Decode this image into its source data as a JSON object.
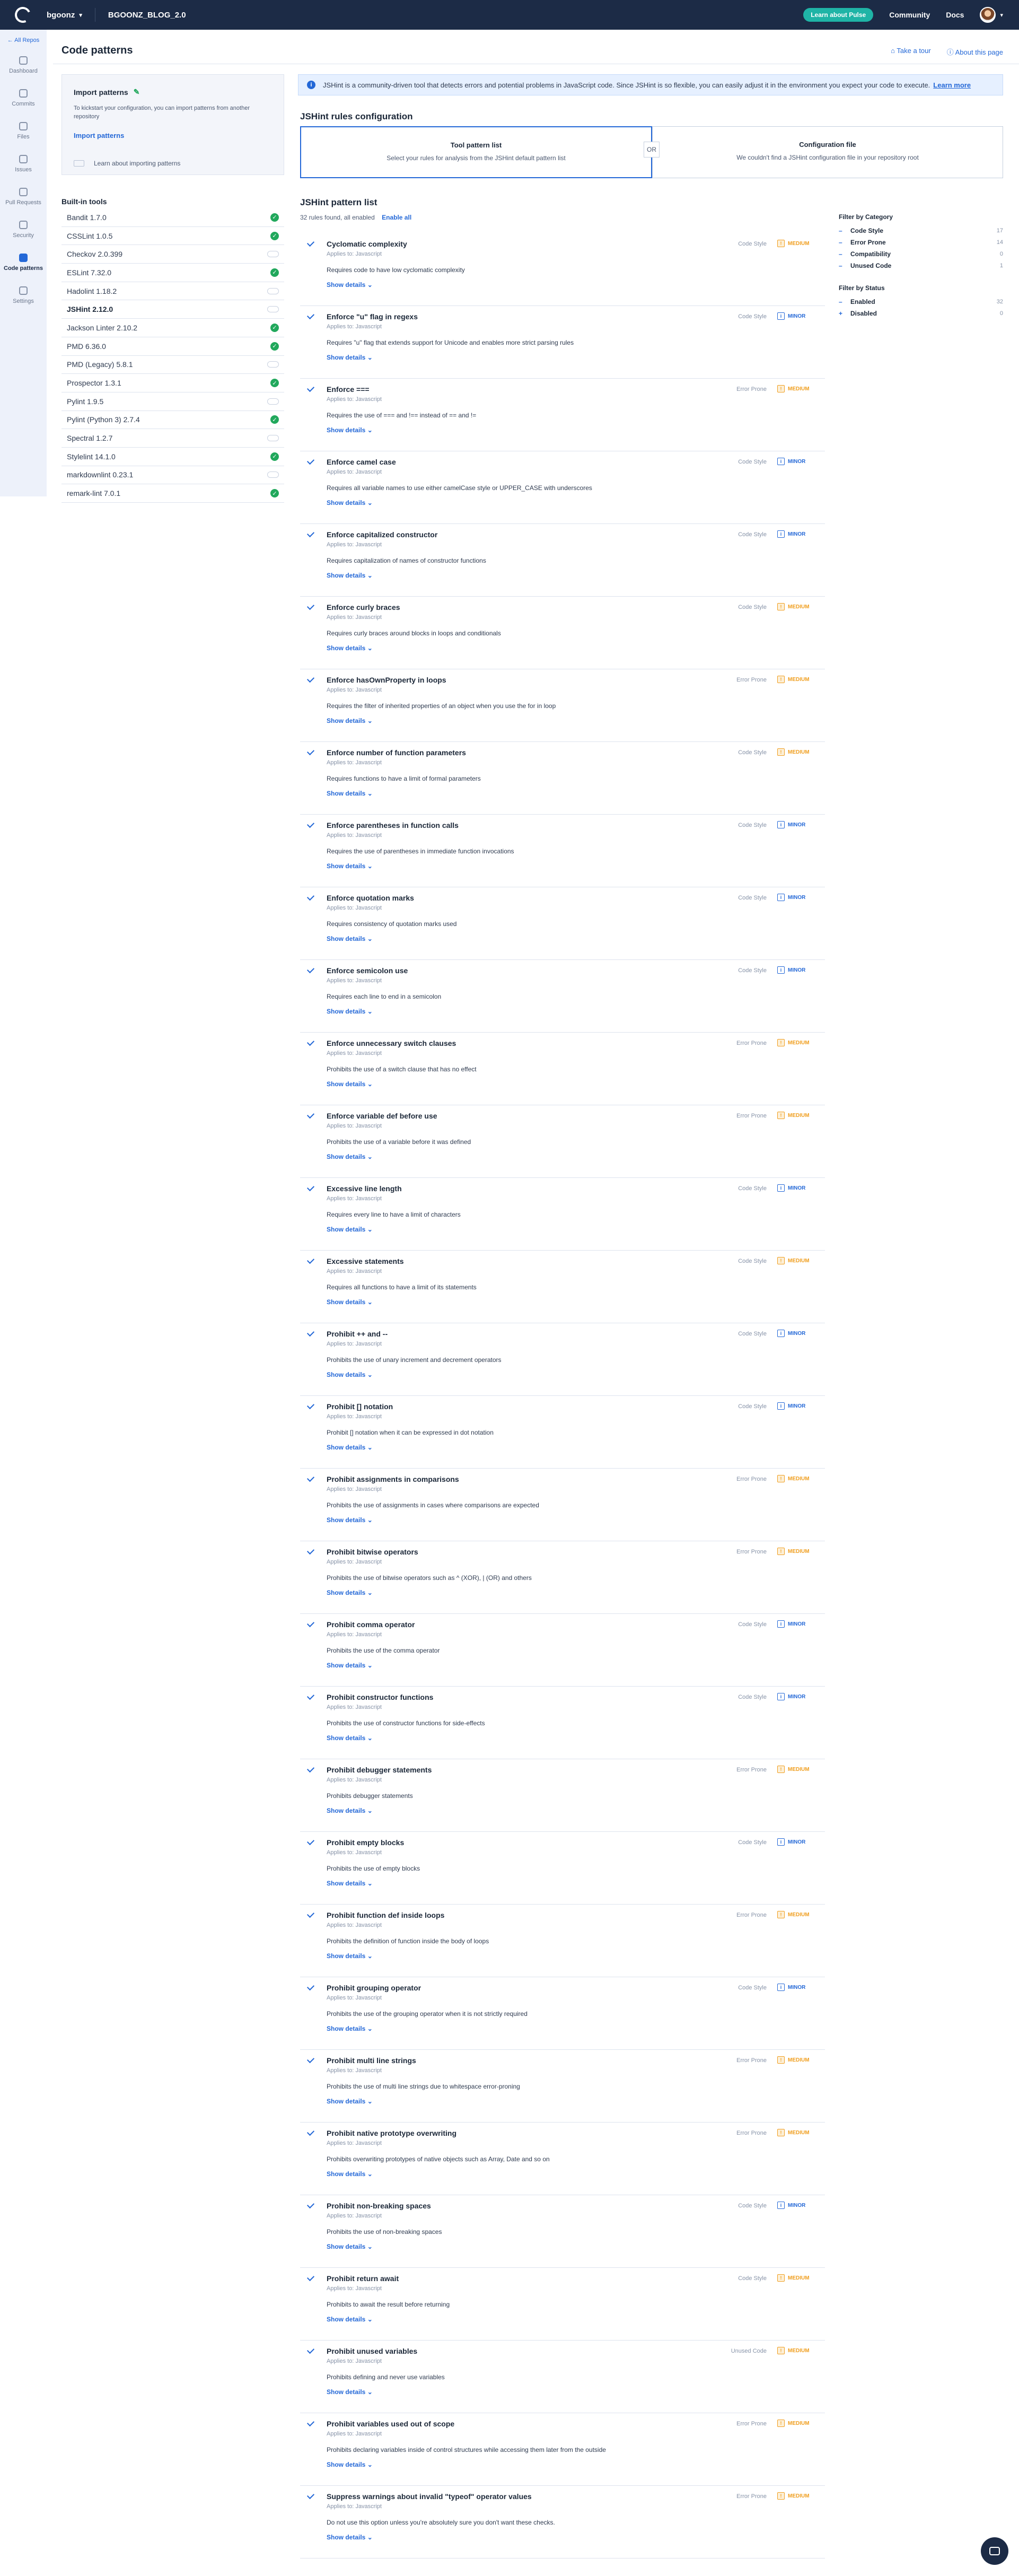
{
  "topbar": {
    "org": "bgoonz",
    "repo": "BGOONZ_BLOG_2.0",
    "pulse_button": "Learn about Pulse",
    "community": "Community",
    "docs": "Docs"
  },
  "sidebar": {
    "back": "← All Repos",
    "items": [
      {
        "label": "Dashboard",
        "icon": "dashboard-icon"
      },
      {
        "label": "Commits",
        "icon": "commits-icon"
      },
      {
        "label": "Files",
        "icon": "files-icon"
      },
      {
        "label": "Issues",
        "icon": "issues-icon"
      },
      {
        "label": "Pull Requests",
        "icon": "pull-requests-icon"
      },
      {
        "label": "Security",
        "icon": "security-icon"
      },
      {
        "label": "Code patterns",
        "icon": "code-patterns-icon"
      },
      {
        "label": "Settings",
        "icon": "settings-icon"
      }
    ]
  },
  "header": {
    "title": "Code patterns",
    "take_tour": "Take a tour",
    "about_page": "About this page"
  },
  "import": {
    "title": "Import patterns",
    "description": "To kickstart your configuration, you can import patterns from another repository",
    "link": "Import patterns",
    "learn": "Learn about importing patterns"
  },
  "builtin": {
    "title": "Built-in tools",
    "tools": [
      {
        "name": "Bandit 1.7.0",
        "enabled": true
      },
      {
        "name": "CSSLint 1.0.5",
        "enabled": true
      },
      {
        "name": "Checkov 2.0.399",
        "enabled": false
      },
      {
        "name": "ESLint 7.32.0",
        "enabled": true
      },
      {
        "name": "Hadolint 1.18.2",
        "enabled": false
      },
      {
        "name": "JSHint 2.12.0",
        "enabled": false,
        "selected": true
      },
      {
        "name": "Jackson Linter 2.10.2",
        "enabled": true
      },
      {
        "name": "PMD 6.36.0",
        "enabled": true
      },
      {
        "name": "PMD (Legacy) 5.8.1",
        "enabled": false
      },
      {
        "name": "Prospector 1.3.1",
        "enabled": true
      },
      {
        "name": "Pylint 1.9.5",
        "enabled": false
      },
      {
        "name": "Pylint (Python 3) 2.7.4",
        "enabled": true
      },
      {
        "name": "Spectral 1.2.7",
        "enabled": false
      },
      {
        "name": "Stylelint 14.1.0",
        "enabled": true
      },
      {
        "name": "markdownlint 0.23.1",
        "enabled": false
      },
      {
        "name": "remark-lint 7.0.1",
        "enabled": true
      }
    ]
  },
  "banner": {
    "text": "JSHint is a community-driven tool that detects errors and potential problems in JavaScript code. Since JSHint is so flexible, you can easily adjust it in the environment you expect your code to execute.",
    "link": "Learn more"
  },
  "config": {
    "title": "JSHint rules configuration",
    "option1_title": "Tool pattern list",
    "option1_desc": "Select your rules for analysis from the JSHint default pattern list",
    "or": "OR",
    "option2_title": "Configuration file",
    "option2_desc": "We couldn't find a JSHint configuration file in your repository root"
  },
  "rules_header": {
    "title": "JSHint pattern list",
    "summary": "32 rules found, all enabled",
    "enable_all": "Enable all"
  },
  "applies_to": "Applies to:",
  "language": "Javascript",
  "show_details": "Show details",
  "rules": [
    {
      "name": "Cyclomatic complexity",
      "desc": "Requires code to have low cyclomatic complexity",
      "cat": "Code Style",
      "sev": "MEDIUM"
    },
    {
      "name": "Enforce \"u\" flag in regexs",
      "desc": "Requires \"u\" flag that extends support for Unicode and enables more strict parsing rules",
      "cat": "Code Style",
      "sev": "MINOR"
    },
    {
      "name": "Enforce ===",
      "desc": "Requires the use of === and !== instead of == and !=",
      "cat": "Error Prone",
      "sev": "MEDIUM"
    },
    {
      "name": "Enforce camel case",
      "desc": "Requires all variable names to use either camelCase style or UPPER_CASE with underscores",
      "cat": "Code Style",
      "sev": "MINOR"
    },
    {
      "name": "Enforce capitalized constructor",
      "desc": "Requires capitalization of names of constructor functions",
      "cat": "Code Style",
      "sev": "MINOR"
    },
    {
      "name": "Enforce curly braces",
      "desc": "Requires curly braces around blocks in loops and conditionals",
      "cat": "Code Style",
      "sev": "MEDIUM"
    },
    {
      "name": "Enforce hasOwnProperty in loops",
      "desc": "Requires the filter of inherited properties of an object when you use the for in loop",
      "cat": "Error Prone",
      "sev": "MEDIUM"
    },
    {
      "name": "Enforce number of function parameters",
      "desc": "Requires functions to have a limit of formal parameters",
      "cat": "Code Style",
      "sev": "MEDIUM"
    },
    {
      "name": "Enforce parentheses in function calls",
      "desc": "Requires the use of parentheses in immediate function invocations",
      "cat": "Code Style",
      "sev": "MINOR"
    },
    {
      "name": "Enforce quotation marks",
      "desc": "Requires consistency of quotation marks used",
      "cat": "Code Style",
      "sev": "MINOR"
    },
    {
      "name": "Enforce semicolon use",
      "desc": "Requires each line to end in a semicolon",
      "cat": "Code Style",
      "sev": "MINOR"
    },
    {
      "name": "Enforce unnecessary switch clauses",
      "desc": "Prohibits the use of a switch clause that has no effect",
      "cat": "Error Prone",
      "sev": "MEDIUM"
    },
    {
      "name": "Enforce variable def before use",
      "desc": "Prohibits the use of a variable before it was defined",
      "cat": "Error Prone",
      "sev": "MEDIUM"
    },
    {
      "name": "Excessive line length",
      "desc": "Requires every line to have a limit of characters",
      "cat": "Code Style",
      "sev": "MINOR"
    },
    {
      "name": "Excessive statements",
      "desc": "Requires all functions to have a limit of its statements",
      "cat": "Code Style",
      "sev": "MEDIUM"
    },
    {
      "name": "Prohibit ++ and --",
      "desc": "Prohibits the use of unary increment and decrement operators",
      "cat": "Code Style",
      "sev": "MINOR"
    },
    {
      "name": "Prohibit [] notation",
      "desc": "Prohibit [] notation when it can be expressed in dot notation",
      "cat": "Code Style",
      "sev": "MINOR"
    },
    {
      "name": "Prohibit assignments in comparisons",
      "desc": "Prohibits the use of assignments in cases where comparisons are expected",
      "cat": "Error Prone",
      "sev": "MEDIUM"
    },
    {
      "name": "Prohibit bitwise operators",
      "desc": "Prohibits the use of bitwise operators such as ^ (XOR), | (OR) and others",
      "cat": "Error Prone",
      "sev": "MEDIUM"
    },
    {
      "name": "Prohibit comma operator",
      "desc": "Prohibits the use of the comma operator",
      "cat": "Code Style",
      "sev": "MINOR"
    },
    {
      "name": "Prohibit constructor functions",
      "desc": "Prohibits the use of constructor functions for side-effects",
      "cat": "Code Style",
      "sev": "MINOR"
    },
    {
      "name": "Prohibit debugger statements",
      "desc": "Prohibits debugger statements",
      "cat": "Error Prone",
      "sev": "MEDIUM"
    },
    {
      "name": "Prohibit empty blocks",
      "desc": "Prohibits the use of empty blocks",
      "cat": "Code Style",
      "sev": "MINOR"
    },
    {
      "name": "Prohibit function def inside loops",
      "desc": "Prohibits the definition of function inside the body of loops",
      "cat": "Error Prone",
      "sev": "MEDIUM"
    },
    {
      "name": "Prohibit grouping operator",
      "desc": "Prohibits the use of the grouping operator when it is not strictly required",
      "cat": "Code Style",
      "sev": "MINOR"
    },
    {
      "name": "Prohibit multi line strings",
      "desc": "Prohibits the use of multi line strings due to whitespace error-proning",
      "cat": "Error Prone",
      "sev": "MEDIUM"
    },
    {
      "name": "Prohibit native prototype overwriting",
      "desc": "Prohibits overwriting prototypes of native objects such as Array, Date and so on",
      "cat": "Error Prone",
      "sev": "MEDIUM"
    },
    {
      "name": "Prohibit non-breaking spaces",
      "desc": "Prohibits the use of non-breaking spaces",
      "cat": "Code Style",
      "sev": "MINOR"
    },
    {
      "name": "Prohibit return await",
      "desc": "Prohibits to await the result before returning",
      "cat": "Code Style",
      "sev": "MEDIUM"
    },
    {
      "name": "Prohibit unused variables",
      "desc": "Prohibits defining and never use variables",
      "cat": "Unused Code",
      "sev": "MEDIUM"
    },
    {
      "name": "Prohibit variables used out of scope",
      "desc": "Prohibits declaring variables inside of control structures while accessing them later from the outside",
      "cat": "Error Prone",
      "sev": "MEDIUM"
    },
    {
      "name": "Suppress warnings about invalid \"typeof\" operator values",
      "desc": "Do not use this option unless you're absolutely sure you don't want these checks.",
      "cat": "Error Prone",
      "sev": "MEDIUM"
    }
  ],
  "filters": {
    "category_title": "Filter by Category",
    "categories": [
      {
        "label": "Code Style",
        "count": "17"
      },
      {
        "label": "Error Prone",
        "count": "14"
      },
      {
        "label": "Compatibility",
        "count": "0"
      },
      {
        "label": "Unused Code",
        "count": "1"
      }
    ],
    "status_title": "Filter by Status",
    "statuses": [
      {
        "label": "Enabled",
        "count": "32",
        "mark": "–"
      },
      {
        "label": "Disabled",
        "count": "0",
        "mark": "+"
      }
    ]
  }
}
